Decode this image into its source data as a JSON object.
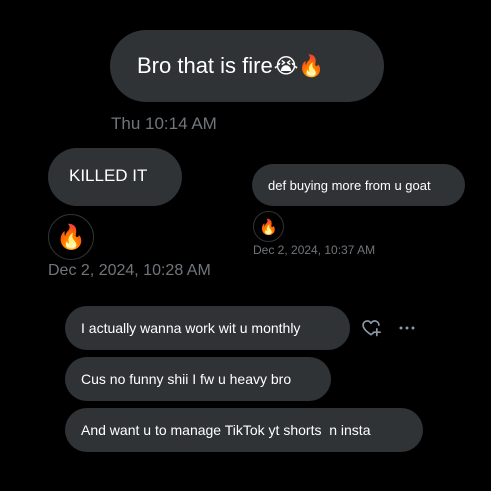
{
  "messages": [
    {
      "text": "Bro that is fire",
      "emojis": [
        "😭",
        "🔥"
      ]
    },
    {
      "text": "KILLED IT"
    },
    {
      "text": "def buying more from u goat"
    },
    {
      "text": "I actually wanna work wit u monthly"
    },
    {
      "text": "Cus no funny shii I fw u heavy bro"
    },
    {
      "text": "And want u to manage TikTok yt shorts  n insta"
    }
  ],
  "timestamps": {
    "first": "Thu 10:14 AM",
    "left": "Dec 2, 2024, 10:28 AM",
    "right": "Dec 2, 2024, 10:37 AM"
  },
  "reactions": {
    "left": "🔥",
    "right": "🔥"
  },
  "icons": {
    "react": "heart-plus-icon",
    "more": "more-dots-icon"
  },
  "colors": {
    "background": "#000000",
    "bubble": "#2f3336",
    "timestamp": "#71767b",
    "text": "#ffffff"
  }
}
